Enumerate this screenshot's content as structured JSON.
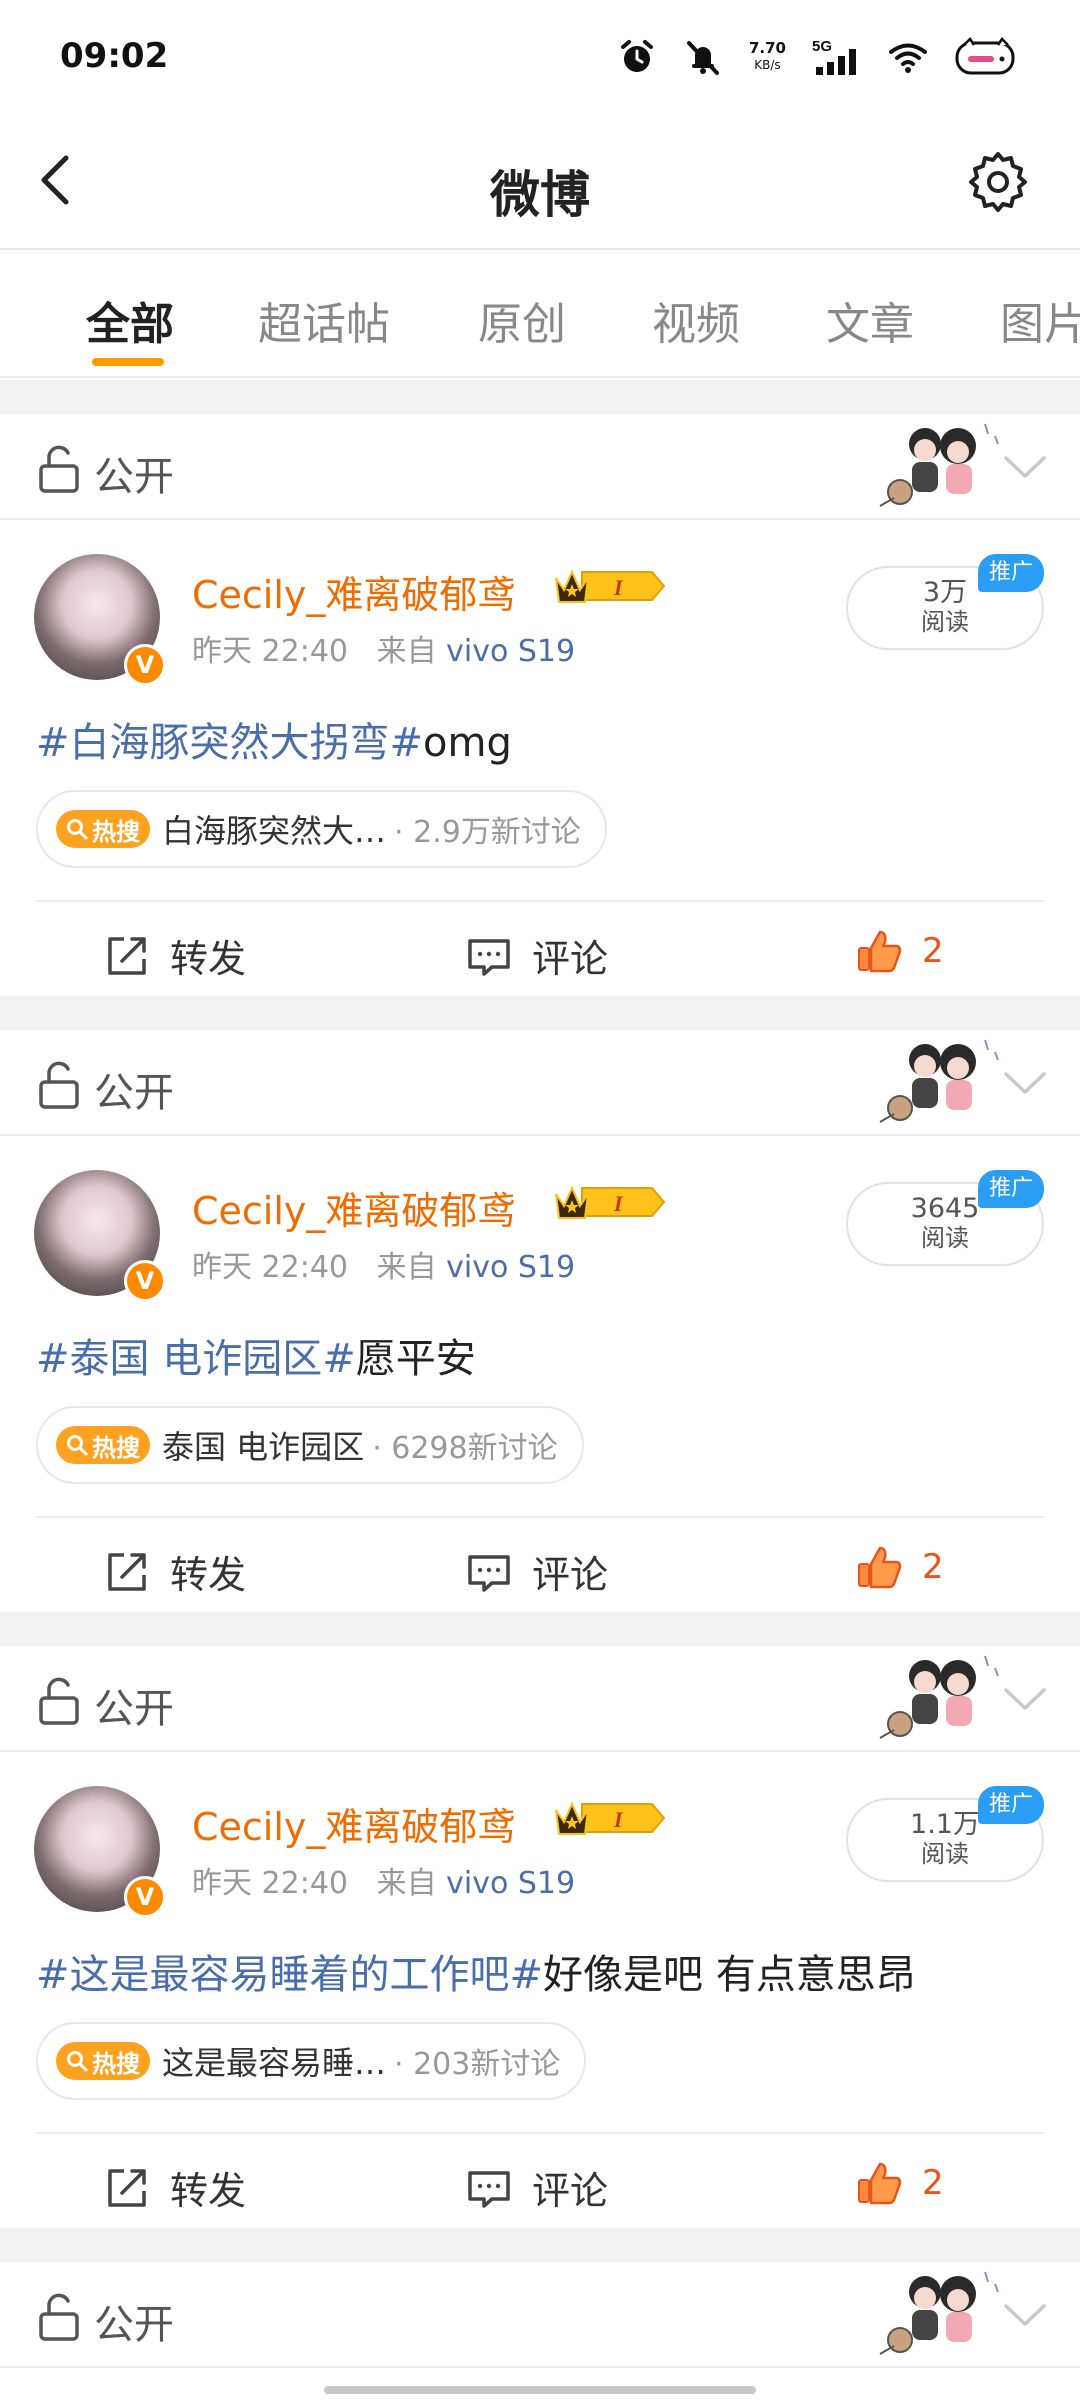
{
  "status_bar": {
    "time": "09:02",
    "net_speed": "7.70",
    "net_speed_unit": "KB/s",
    "network": "5G",
    "icons": [
      "alarm-icon",
      "mute-icon",
      "signal-icon",
      "wifi-icon",
      "battery-icon"
    ]
  },
  "header": {
    "title": "微博",
    "back_icon": "back-icon",
    "settings_icon": "gear-icon"
  },
  "tabs": [
    {
      "label": "全部",
      "active": true
    },
    {
      "label": "超话帖",
      "active": false
    },
    {
      "label": "原创",
      "active": false
    },
    {
      "label": "视频",
      "active": false
    },
    {
      "label": "文章",
      "active": false
    },
    {
      "label": "图片",
      "active": false
    }
  ],
  "colors": {
    "accent": "#ff9a00",
    "username": "#f06b00",
    "topic": "#4a6ea9",
    "like": "#e8541c",
    "promo": "#2a9df4"
  },
  "posts": [
    {
      "visibility": "公开",
      "username": "Cecily_难离破郁鸢",
      "time": "昨天 22:40",
      "source_prefix": "来自",
      "source": "vivo S19",
      "reads": "3万",
      "reads_label": "阅读",
      "promo": "推广",
      "text_tag": "#白海豚突然大拐弯#",
      "text_rest": "omg",
      "hot_badge": "热搜",
      "hot_topic": "白海豚突然大…",
      "hot_count": "· 2.9万新讨论",
      "repost": "转发",
      "comment": "评论",
      "likes": "2"
    },
    {
      "visibility": "公开",
      "username": "Cecily_难离破郁鸢",
      "time": "昨天 22:40",
      "source_prefix": "来自",
      "source": "vivo S19",
      "reads": "3645",
      "reads_label": "阅读",
      "promo": "推广",
      "text_tag": "#泰国 电诈园区#",
      "text_rest": "愿平安",
      "hot_badge": "热搜",
      "hot_topic": "泰国 电诈园区",
      "hot_count": "· 6298新讨论",
      "repost": "转发",
      "comment": "评论",
      "likes": "2"
    },
    {
      "visibility": "公开",
      "username": "Cecily_难离破郁鸢",
      "time": "昨天 22:40",
      "source_prefix": "来自",
      "source": "vivo S19",
      "reads": "1.1万",
      "reads_label": "阅读",
      "promo": "推广",
      "text_tag": "#这是最容易睡着的工作吧#",
      "text_rest": "好像是吧 有点意思昂",
      "hot_badge": "热搜",
      "hot_topic": "这是最容易睡…",
      "hot_count": "· 203新讨论",
      "repost": "转发",
      "comment": "评论",
      "likes": "2"
    }
  ],
  "partial_post": {
    "visibility": "公开"
  }
}
